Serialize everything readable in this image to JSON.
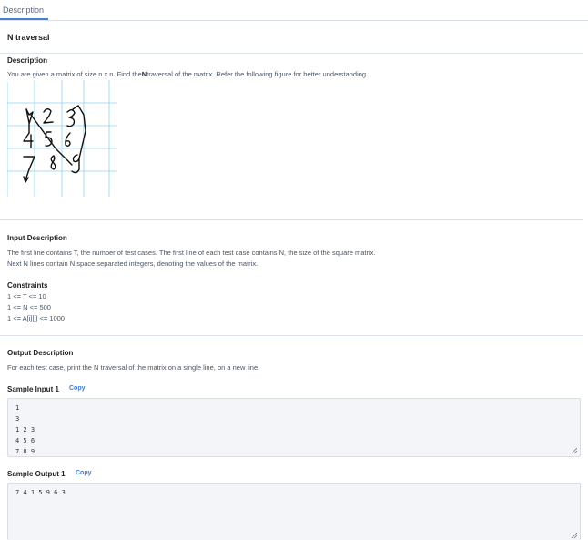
{
  "tabs": {
    "description": "Description"
  },
  "problem": {
    "title": "N traversal",
    "description_heading": "Description",
    "description_text_1": "You are given a matrix of size n x n. Find the",
    "description_text_bold": "N",
    "description_text_2": "traversal of the matrix. Refer the following figure for better understanding.",
    "input_heading": "Input Description",
    "input_line_1": "The first line contains T, the number of test cases. The first line of each test case contains N, the size of the square matrix.",
    "input_line_2": "Next N lines contain N space separated integers, denoting the values of the matrix.",
    "constraints_heading": "Constraints",
    "constraint_1": "1 <= T <= 10",
    "constraint_2": "1 <= N <= 500",
    "constraint_3": "1 <= A[i][j] <= 1000",
    "output_heading": "Output Description",
    "output_line": "For each test case, print the N traversal of the matrix on a single line, on a new line.",
    "sample_input_label": "Sample Input 1",
    "sample_input_copy": "Copy",
    "sample_input_lines": [
      "1",
      "3",
      "1 2 3",
      "4 5 6",
      "7 8 9"
    ],
    "sample_output_label": "Sample Output 1",
    "sample_output_copy": "Copy",
    "sample_output_lines": [
      "7 4 1 5 9 6 3"
    ]
  },
  "figure": {
    "digits": [
      "1",
      "2",
      "3",
      "4",
      "5",
      "6",
      "7",
      "8",
      "9"
    ]
  },
  "colors": {
    "accent": "#4a7fd6",
    "grid": "#8fd3f0",
    "divider": "#dde3ea"
  }
}
